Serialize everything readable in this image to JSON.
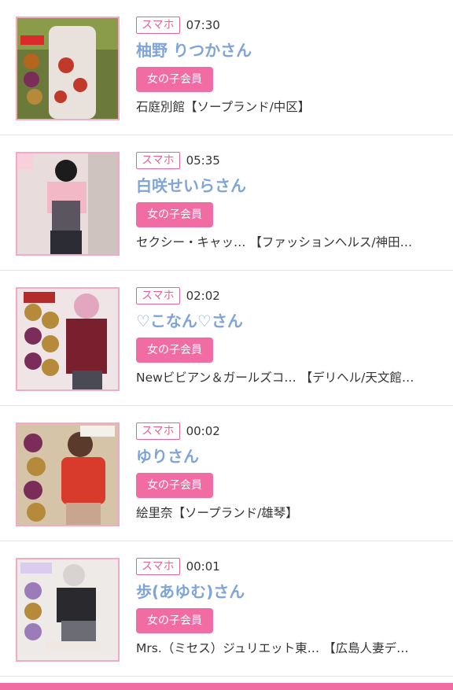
{
  "items": [
    {
      "device": "スマホ",
      "time": "07:30",
      "name": "柚野 りつかさん",
      "member": "女の子会員",
      "shop": "石庭別館【ソープランド/中区】",
      "photo_colors": {
        "bg": "#6b7a3a",
        "body": "#e9e1dc",
        "accent": "#c0392b"
      }
    },
    {
      "device": "スマホ",
      "time": "05:35",
      "name": "白咲せいらさん",
      "member": "女の子会員",
      "shop": "セクシー・キャッ… 【ファッションヘルス/神田…",
      "photo_colors": {
        "bg": "#e8dcdc",
        "body": "#5b5560",
        "accent": "#f2b8c6"
      }
    },
    {
      "device": "スマホ",
      "time": "02:02",
      "name": "♡こなん♡さん",
      "member": "女の子会員",
      "shop": "Newビビアン＆ガールズコ… 【デリヘル/天文館…",
      "photo_colors": {
        "bg": "#efe4e6",
        "body": "#7a1f2e",
        "accent": "#b58a3b"
      }
    },
    {
      "device": "スマホ",
      "time": "00:02",
      "name": "ゆりさん",
      "member": "女の子会員",
      "shop": "絵里奈【ソープランド/雄琴】",
      "photo_colors": {
        "bg": "#d6c4a8",
        "body": "#d83a2c",
        "accent": "#7a2d58"
      }
    },
    {
      "device": "スマホ",
      "time": "00:01",
      "name": "歩(あゆむ)さん",
      "member": "女の子会員",
      "shop": "Mrs.（ミセス）ジュリエット東… 【広島人妻デ…",
      "photo_colors": {
        "bg": "#eeeae8",
        "body": "#2a2a2e",
        "accent": "#9b7bb8"
      }
    }
  ]
}
